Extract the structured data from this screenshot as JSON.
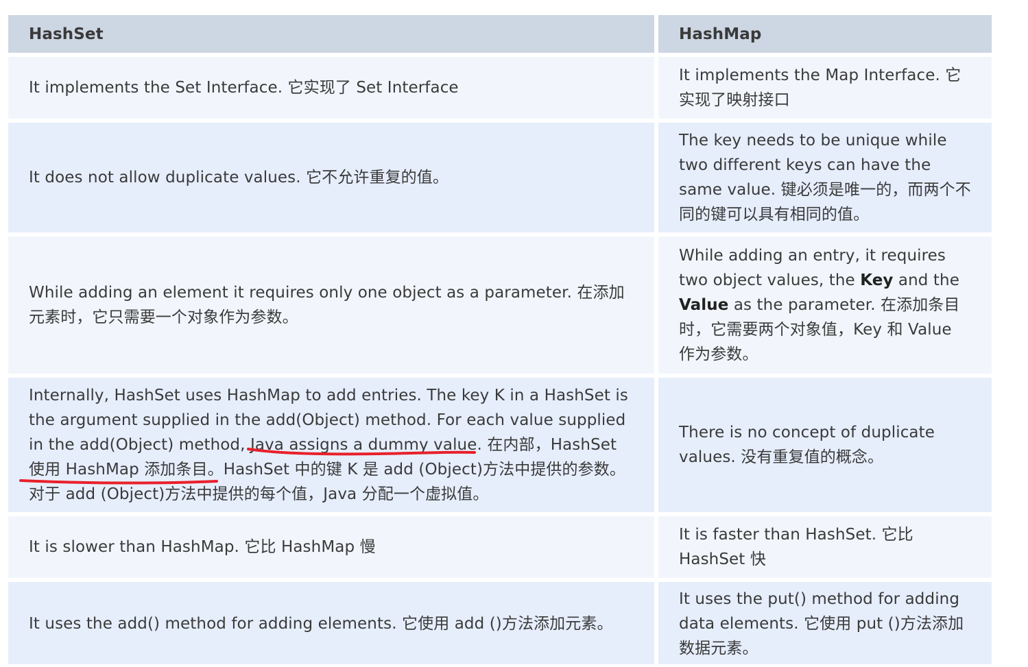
{
  "table": {
    "headers": [
      "HashSet",
      "HashMap"
    ],
    "rows": [
      {
        "hashset": "It implements the Set Interface.  它实现了 Set Interface",
        "hashmap": "It implements the Map Interface.  它实现了映射接口"
      },
      {
        "hashset": "It does not allow duplicate values. 它不允许重复的值。",
        "hashmap": "The key needs to be unique while two different keys can have the same value. 键必须是唯一的，而两个不同的键可以具有相同的值。"
      },
      {
        "hashset": "While adding an element it requires only one object as a parameter. 在添加元素时，它只需要一个对象作为参数。",
        "hashmap_parts": {
          "p1": "While adding an entry, it requires two object values, the ",
          "key": "Key",
          "p2": " and the ",
          "value": "Value",
          "p3": " as the parameter. 在添加条目时，它需要两个对象值，Key 和 Value 作为参数。"
        }
      },
      {
        "hashset_parts": {
          "p1": "Internally, HashSet uses HashMap to add entries. The key K in a HashSet is the argument supplied in the add(Object) method. For each value supplied in the add(Object) method, ",
          "u1": "Java assigns a dummy value.",
          "p2": " 在内部，HashSet ",
          "u2": "使用 HashMap 添加条目。",
          "p3": "HashSet 中的键 K 是 add (Object)方法中提供的参数。对于 add (Object)方法中提供的每个值，Java 分配一个虚拟值。"
        },
        "hashmap": "There is no concept of duplicate values. 没有重复值的概念。"
      },
      {
        "hashset": "It is slower than HashMap.  它比 HashMap 慢",
        "hashmap": "It is faster than HashSet.  它比 HashSet 快"
      },
      {
        "hashset": "It uses the add() method for adding elements. 它使用 add ()方法添加元素。",
        "hashmap": "It uses the put() method for adding data elements. 它使用 put ()方法添加数据元素。"
      }
    ]
  },
  "colors": {
    "header_bg": "#cdd6e3",
    "row_odd_bg": "#f2f6fc",
    "row_even_bg": "#e6eefc",
    "annotation": "#e8202a"
  }
}
